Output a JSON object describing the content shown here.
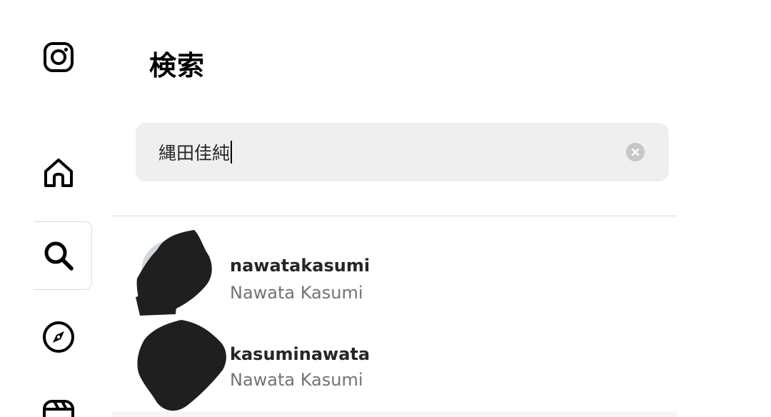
{
  "sidebar": {
    "logo_icon": "instagram-logo-icon",
    "items": [
      {
        "icon": "home-icon"
      },
      {
        "icon": "search-icon",
        "active": true
      },
      {
        "icon": "compass-icon"
      },
      {
        "icon": "reels-icon"
      }
    ]
  },
  "search": {
    "title": "検索",
    "query": "縄田佳純",
    "clear_icon": "clear-circle-icon"
  },
  "results": [
    {
      "username": "nawatakasumi",
      "full_name": "Nawata Kasumi"
    },
    {
      "username": "kasuminawata",
      "full_name": "Nawata Kasumi"
    }
  ],
  "colors": {
    "search_bg": "#efefef",
    "secondary_text": "#737373",
    "divider": "#dbdbdb"
  }
}
